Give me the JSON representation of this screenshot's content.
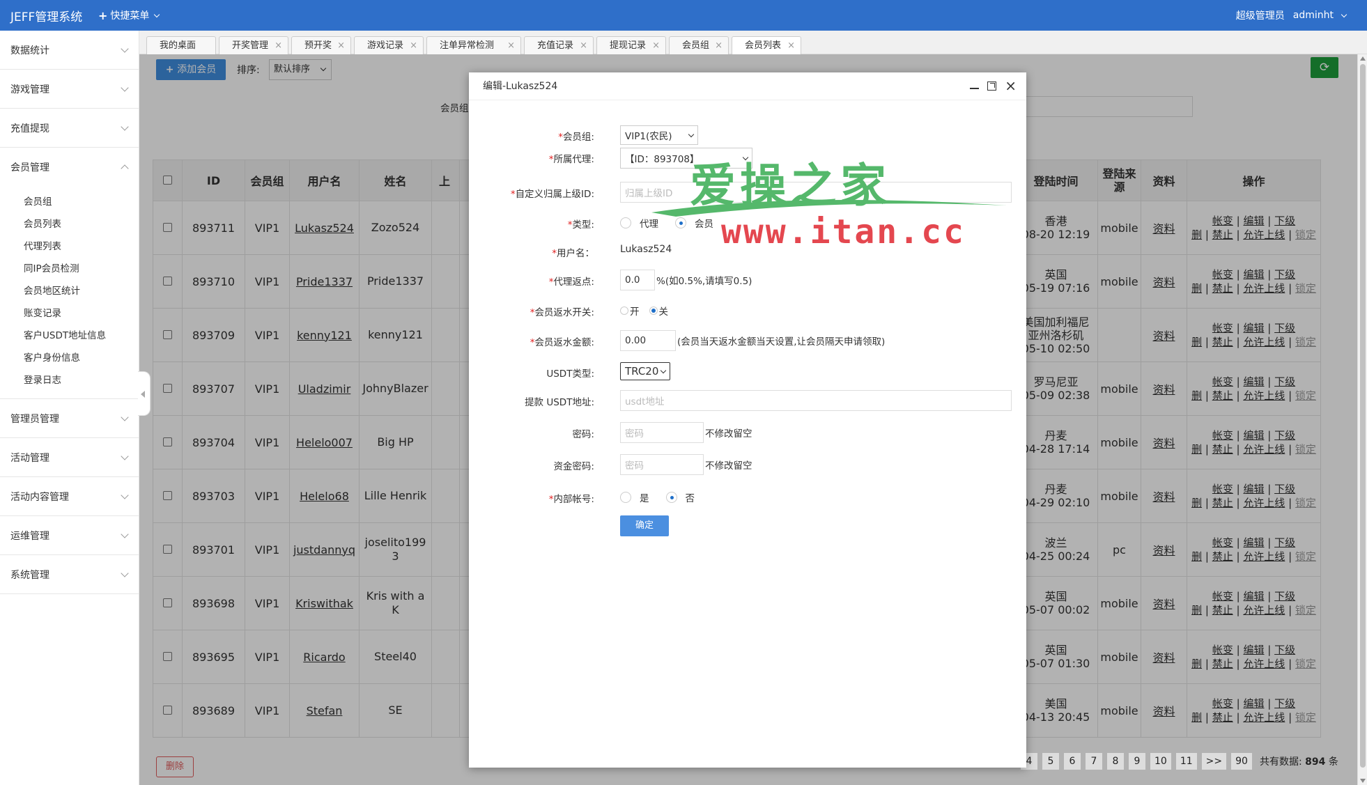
{
  "header": {
    "brand": "JEFF管理系统",
    "quick_menu": "快捷菜单",
    "role": "超级管理员",
    "user": "adminht"
  },
  "sidebar": {
    "menus": [
      {
        "label": "数据统计"
      },
      {
        "label": "游戏管理"
      },
      {
        "label": "充值提现"
      },
      {
        "label": "会员管理",
        "expanded": true,
        "children": [
          "会员组",
          "会员列表",
          "代理列表",
          "同IP会员检测",
          "会员地区统计",
          "账变记录",
          "客户USDT地址信息",
          "客户身份信息",
          "登录日志"
        ]
      },
      {
        "label": "管理员管理"
      },
      {
        "label": "活动管理"
      },
      {
        "label": "活动内容管理"
      },
      {
        "label": "运维管理"
      },
      {
        "label": "系统管理"
      }
    ]
  },
  "tabs": [
    "我的桌面",
    "开奖管理",
    "预开奖",
    "游戏记录",
    "注单异常检测",
    "充值记录",
    "提现记录",
    "会员组",
    "会员列表"
  ],
  "toolbar": {
    "add_label": "添加会员",
    "sort_label": "排序:",
    "sort_value": "默认排序",
    "filter_label": "会员组",
    "refresh_icon": "⟳"
  },
  "table": {
    "headers": [
      "ID",
      "会员组",
      "用户名",
      "姓名",
      "上",
      "登陆时间",
      "登陆来源",
      "资料",
      "操作"
    ],
    "rows": [
      {
        "id": "893711",
        "group": "VIP1",
        "username": "Lukasz524",
        "name": "Zozo524",
        "loc": "香港",
        "time": "08-20 12:19",
        "source": "mobile",
        "info": "资料"
      },
      {
        "id": "893710",
        "group": "VIP1",
        "username": "Pride1337",
        "name": "Pride1337",
        "loc": "英国",
        "time": "05-19 07:16",
        "source": "mobile",
        "info": "资料"
      },
      {
        "id": "893709",
        "group": "VIP1",
        "username": "kenny121",
        "name": "kenny121",
        "loc": "美国加利福尼亚州洛杉矶",
        "time": "05-10 02:50",
        "source": "",
        "info": "资料"
      },
      {
        "id": "893707",
        "group": "VIP1",
        "username": "Uladzimir",
        "name": "JohnyBlazer",
        "loc": "罗马尼亚",
        "time": "05-09 02:38",
        "source": "mobile",
        "info": "资料"
      },
      {
        "id": "893704",
        "group": "VIP1",
        "username": "Helelo007",
        "name": "Big HP",
        "loc": "丹麦",
        "time": "04-28 17:14",
        "source": "mobile",
        "info": "资料"
      },
      {
        "id": "893703",
        "group": "VIP1",
        "username": "Helelo68",
        "name": "Lille Henrik",
        "loc": "丹麦",
        "time": "04-29 02:10",
        "source": "mobile",
        "info": "资料"
      },
      {
        "id": "893701",
        "group": "VIP1",
        "username": "justdannyq",
        "name": "joselito1993",
        "loc": "波兰",
        "time": "04-25 00:24",
        "source": "pc",
        "info": "资料"
      },
      {
        "id": "893698",
        "group": "VIP1",
        "username": "Kriswithak",
        "name": "Kris with a K",
        "loc": "英国",
        "time": "05-07 00:02",
        "source": "mobile",
        "info": "资料"
      },
      {
        "id": "893695",
        "group": "VIP1",
        "username": "Ricardo",
        "name": "Steel40",
        "loc": "英国",
        "time": "05-07 01:30",
        "source": "mobile",
        "info": "资料"
      },
      {
        "id": "893689",
        "group": "VIP1",
        "username": "Stefan",
        "name": "SE",
        "loc": "美国",
        "time": "04-13 20:45",
        "source": "mobile",
        "info": "资料"
      }
    ],
    "ops": {
      "zhangbian": "帐变",
      "edit": "编辑",
      "xiaji": "下级",
      "del": "删",
      "ban": "禁止",
      "allow": "允许上线",
      "lock": "锁定"
    }
  },
  "footer": {
    "delete_label": "删除",
    "pages": [
      "4",
      "5",
      "6",
      "7",
      "8",
      "9",
      "10",
      "11",
      ">>",
      "90"
    ],
    "total_label": "共有数据:",
    "total_value": "894",
    "total_unit": "条"
  },
  "modal": {
    "title": "编辑-Lukasz524",
    "group_label": "会员组:",
    "group_value": "VIP1(农民)",
    "agent_label": "所属代理:",
    "agent_value": "【ID：893708】",
    "custom_parent_label": "自定义归属上级ID:",
    "custom_parent_placeholder": "归属上级ID",
    "type_label": "类型:",
    "type_agent": "代理",
    "type_member": "会员",
    "username_label": "用户名：",
    "username_value": "Lukasz524",
    "rebate_label": "代理返点:",
    "rebate_value": "0.0",
    "rebate_hint": "%(如0.5%,请填写0.5)",
    "return_switch_label": "会员返水开关:",
    "on_label": "开",
    "off_label": "关",
    "return_amount_label": "会员返水金额:",
    "return_amount_value": "0.00",
    "return_amount_hint": "(会员当天返水金额当天设置,让会员隔天申请领取)",
    "usdt_type_label": "USDT类型:",
    "usdt_type_value": "TRC20",
    "usdt_addr_label": "提款 USDT地址:",
    "usdt_addr_placeholder": "usdt地址",
    "password_label": "密码:",
    "password_placeholder": "密码",
    "password_hint": "不修改留空",
    "fund_password_label": "资金密码:",
    "fund_password_placeholder": "密码",
    "fund_password_hint": "不修改留空",
    "internal_label": "内部帐号:",
    "yes_label": "是",
    "no_label": "否",
    "submit_label": "确定"
  },
  "watermark": {
    "line1": "爱操之家",
    "line2": "www.itan.cc"
  }
}
